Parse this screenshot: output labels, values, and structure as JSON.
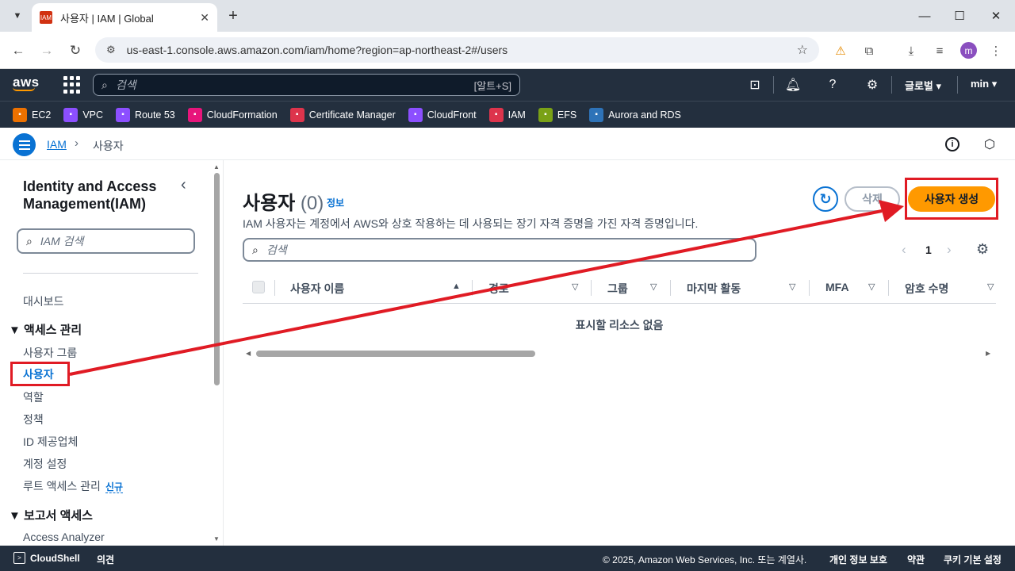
{
  "browser": {
    "tab_title": "사용자 | IAM | Global",
    "url": "us-east-1.console.aws.amazon.com/iam/home?region=ap-northeast-2#/users",
    "profile_initial": "m"
  },
  "aws_header": {
    "logo": "aws",
    "search_placeholder": "검색",
    "search_shortcut": "[알트+S]",
    "region_label": "글로벌 ▾",
    "user_label": "min ▾"
  },
  "favorites": [
    {
      "label": "EC2",
      "color": "#ed7100",
      "icon": "ec2-icon"
    },
    {
      "label": "VPC",
      "color": "#8c4fff",
      "icon": "vpc-icon"
    },
    {
      "label": "Route 53",
      "color": "#8c4fff",
      "icon": "route53-icon"
    },
    {
      "label": "CloudFormation",
      "color": "#e7157b",
      "icon": "cloudformation-icon"
    },
    {
      "label": "Certificate Manager",
      "color": "#dd344c",
      "icon": "certificate-manager-icon"
    },
    {
      "label": "CloudFront",
      "color": "#8c4fff",
      "icon": "cloudfront-icon"
    },
    {
      "label": "IAM",
      "color": "#dd344c",
      "icon": "iam-icon"
    },
    {
      "label": "EFS",
      "color": "#7aa116",
      "icon": "efs-icon"
    },
    {
      "label": "Aurora and RDS",
      "color": "#2e73b8",
      "icon": "rds-icon"
    }
  ],
  "breadcrumb": {
    "root": "IAM",
    "current": "사용자"
  },
  "sidebar": {
    "title": "Identity and Access Management(IAM)",
    "search_placeholder": "IAM 검색",
    "dashboard": "대시보드",
    "section_access": "▼ 액세스 관리",
    "items": [
      "사용자 그룹",
      "사용자",
      "역할",
      "정책",
      "ID 제공업체",
      "계정 설정",
      "루트 액세스 관리"
    ],
    "new_badge": "신규",
    "section_reports": "▼ 보고서 액세스",
    "report_items": [
      "Access Analyzer"
    ]
  },
  "main": {
    "title": "사용자",
    "count": "(0)",
    "info": "정보",
    "description": "IAM 사용자는 계정에서 AWS와 상호 작용하는 데 사용되는 장기 자격 증명을 가진 자격 증명입니다.",
    "delete_label": "삭제",
    "create_label": "사용자 생성",
    "search_placeholder": "검색",
    "page_number": "1",
    "columns": [
      "사용자 이름",
      "경로",
      "그룹",
      "마지막 활동",
      "MFA",
      "암호 수명"
    ],
    "empty_text": "표시할 리소스 없음"
  },
  "footer": {
    "cloudshell": "CloudShell",
    "feedback": "의견",
    "copyright": "© 2025, Amazon Web Services, Inc. 또는 계열사.",
    "privacy": "개인 정보 보호",
    "terms": "약관",
    "cookies": "쿠키 기본 설정"
  },
  "colors": {
    "aws_header": "#232f3e",
    "link": "#0972d3",
    "primary_button": "#ff9900",
    "annotation": "#e01b24"
  }
}
